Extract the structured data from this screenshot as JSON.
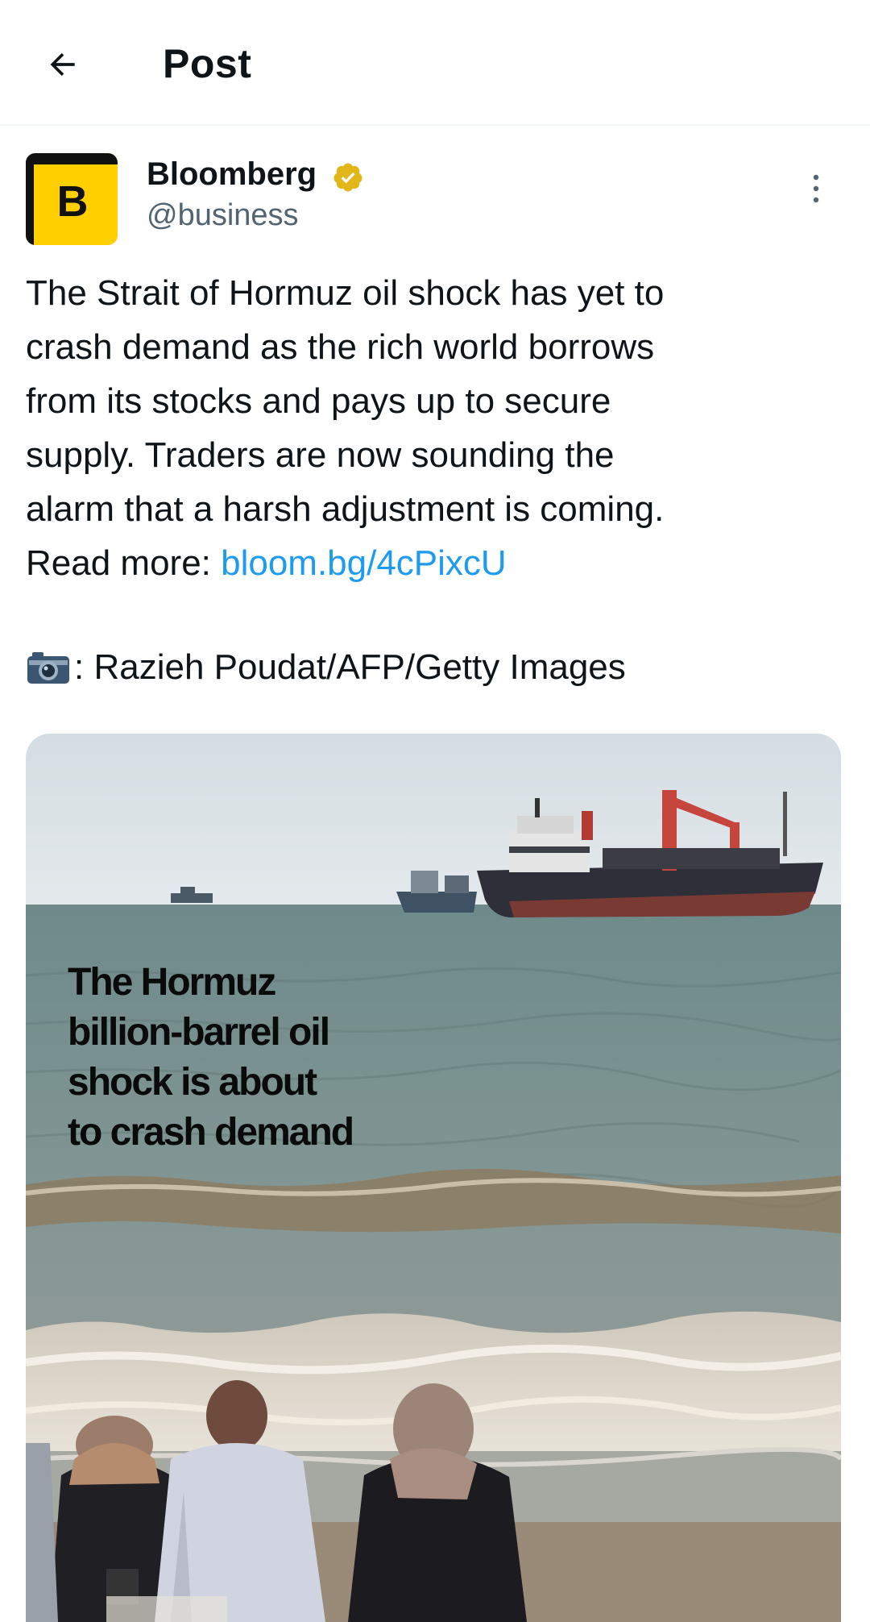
{
  "header": {
    "title": "Post",
    "back_icon": "arrow-left-icon"
  },
  "post": {
    "author": {
      "name": "Bloomberg",
      "handle": "@business",
      "avatar_letter": "B",
      "avatar_color": "#ffcf00",
      "verified_badge_color": "#e2b719"
    },
    "text": "The Strait of Hormuz oil shock has yet to\ncrash demand as the rich world borrows\nfrom its stocks and pays up to secure\nsupply. Traders are now sounding the\nalarm that a harsh adjustment is coming.\nRead more: ",
    "link": "bloom.bg/4cPixcU",
    "link_color": "#1d9bf0",
    "photo_credit": ": Razieh Poudat/AFP/Getty Images",
    "media": {
      "headline": "The Hormuz\nbillion-barrel oil\nshock is about\nto crash demand"
    }
  }
}
